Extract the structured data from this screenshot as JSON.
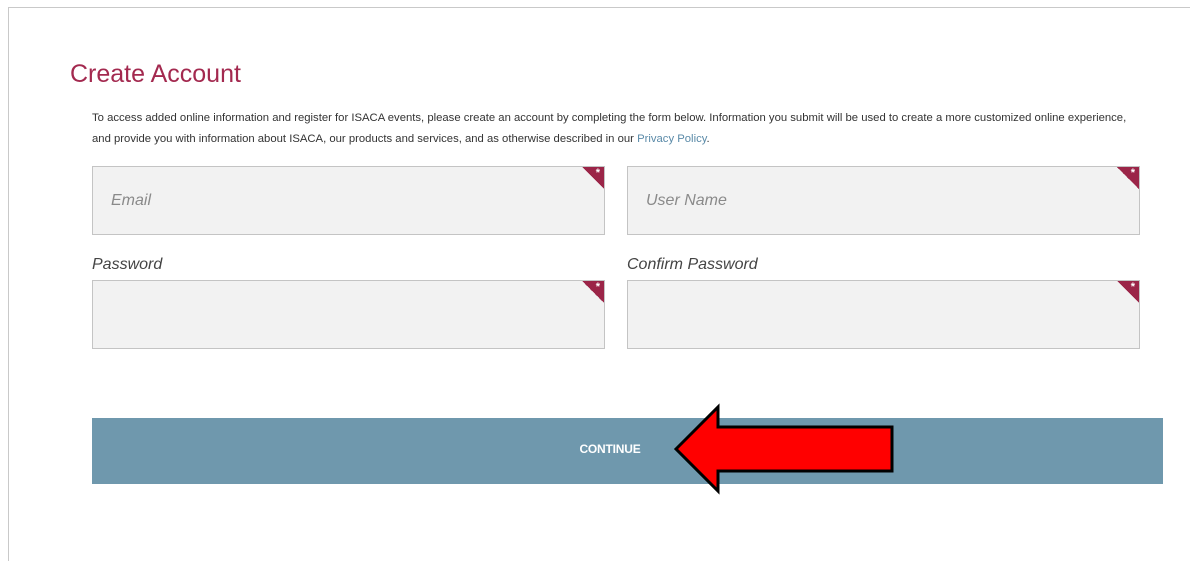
{
  "page": {
    "title": "Create Account",
    "intro_text": "To access added online information and register for ISACA events, please create an account by completing the form below. Information you submit will be used to create a more customized online experience, and provide you with information about ISACA, our products and services, and as otherwise described in our ",
    "privacy_link": "Privacy Policy",
    "intro_end": "."
  },
  "form": {
    "email": {
      "placeholder": "Email",
      "value": "",
      "required_mark": "*"
    },
    "username": {
      "placeholder": "User Name",
      "value": "",
      "required_mark": "*"
    },
    "password": {
      "label": "Password",
      "value": "",
      "required_mark": "*"
    },
    "confirm_password": {
      "label": "Confirm Password",
      "value": "",
      "required_mark": "*"
    },
    "continue_label": "CONTINUE"
  },
  "annotation": {
    "icon": "red-arrow-icon",
    "color": "#ff0000"
  },
  "colors": {
    "accent": "#a3294f",
    "button": "#6f98ad",
    "link": "#5a8aa8"
  }
}
